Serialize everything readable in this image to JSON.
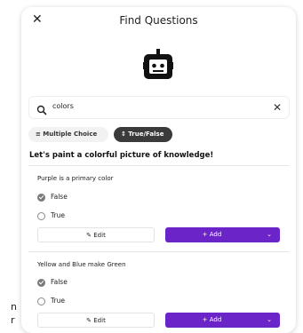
{
  "background": {
    "text_1": "n",
    "text_2": "r"
  },
  "dialog": {
    "title": "Find Questions",
    "close_label": "✕"
  },
  "search": {
    "value": "colors",
    "clear_label": "✕"
  },
  "filters": [
    {
      "label": "≡ Multiple Choice"
    },
    {
      "label": "↕ True/False"
    }
  ],
  "tagline": "Let's paint a colorful picture of knowledge!",
  "questions": [
    {
      "text": "Purple is a primary color",
      "options": [
        {
          "label": "False",
          "selected": true
        },
        {
          "label": "True",
          "selected": false
        }
      ],
      "edit_label": "✎ Edit",
      "add_label": "+ Add"
    },
    {
      "text": "Yellow and Blue make Green",
      "options": [
        {
          "label": "False",
          "selected": true
        },
        {
          "label": "True",
          "selected": false
        }
      ],
      "edit_label": "✎ Edit",
      "add_label": "+ Add"
    }
  ],
  "colors": {
    "accent": "#6a24c8",
    "active_chip": "#3b3b3b"
  }
}
